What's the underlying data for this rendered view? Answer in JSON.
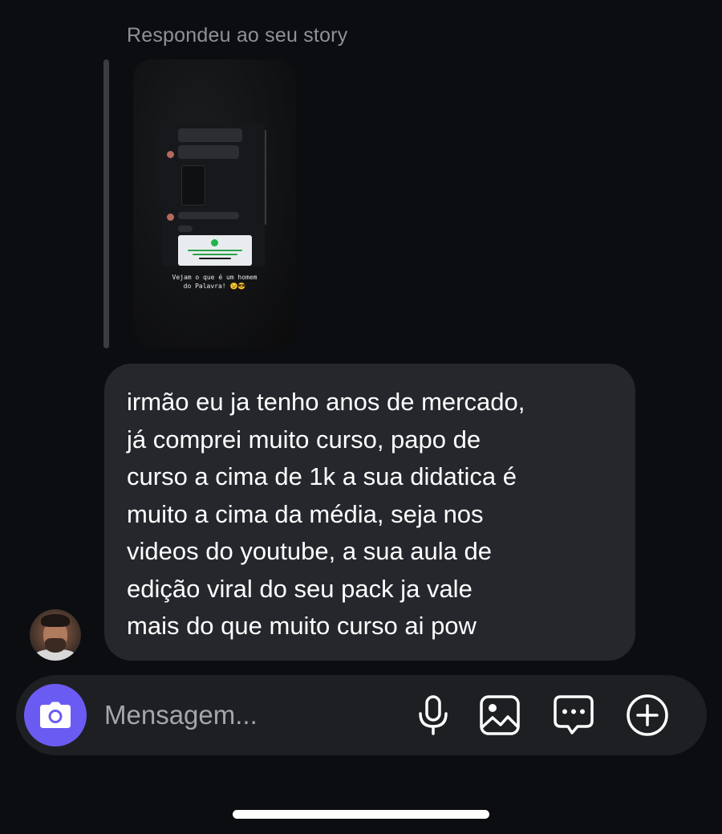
{
  "story_reply": {
    "label": "Respondeu ao seu story",
    "story_caption": "Vejam o que é um homem\ndo Palavra! 😉😎"
  },
  "message": {
    "text": "irmão eu ja tenho anos de mercado,\njá comprei muito curso, papo de\ncurso a cima de 1k a sua didatica é\nmuito a cima da média, seja nos\nvideos do youtube, a sua aula de\nedição viral do seu pack ja vale\nmais do que muito curso ai pow"
  },
  "composer": {
    "placeholder": "Mensagem...",
    "icons": [
      "camera-icon",
      "microphone-icon",
      "image-icon",
      "sticker-icon",
      "plus-icon"
    ]
  },
  "colors": {
    "background": "#0c0d10",
    "bubble": "#25272c",
    "composer": "#1d1f23",
    "camera_accent": "#6a5cf2",
    "label_gray": "#8e9196"
  }
}
